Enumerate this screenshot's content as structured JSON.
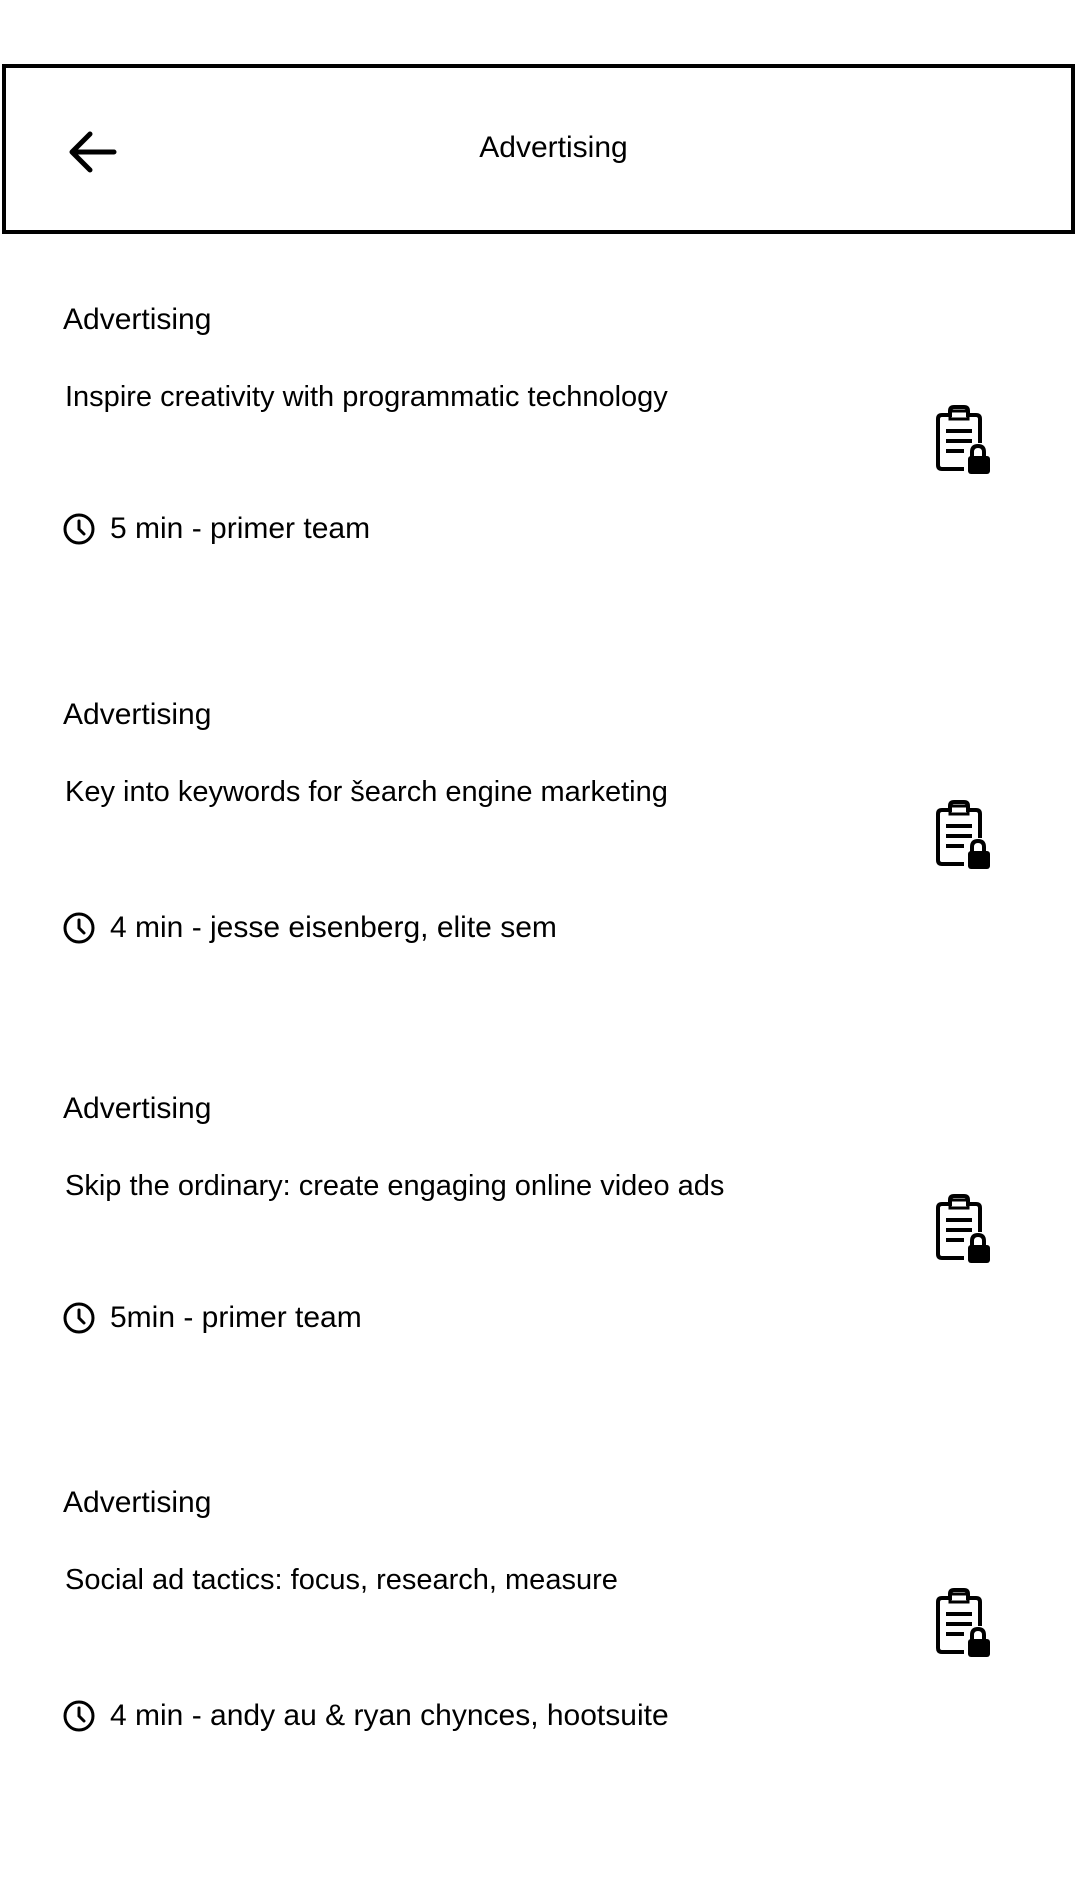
{
  "header": {
    "title": "Advertising",
    "back_icon": "arrow-left-icon"
  },
  "cards": [
    {
      "category": "Advertising",
      "title": "Inspire creativity with programmatic technology",
      "meta": "5 min - primer team",
      "meta_icon": "clock-icon",
      "action_icon": "clipboard-lock-icon"
    },
    {
      "category": "Advertising",
      "title": "Key into keywords for šearch engine marketing",
      "meta": "4 min - jesse eisenberg, elite sem",
      "meta_icon": "clock-icon",
      "action_icon": "clipboard-lock-icon"
    },
    {
      "category": "Advertising",
      "title": "Skip the ordinary: create engaging online video ads",
      "meta": "5min - primer team",
      "meta_icon": "clock-icon",
      "action_icon": "clipboard-lock-icon"
    },
    {
      "category": "Advertising",
      "title": "Social ad tactics: focus, research, measure",
      "meta": "4 min - andy au & ryan chynces, hootsuite",
      "meta_icon": "clock-icon",
      "action_icon": "clipboard-lock-icon"
    }
  ]
}
